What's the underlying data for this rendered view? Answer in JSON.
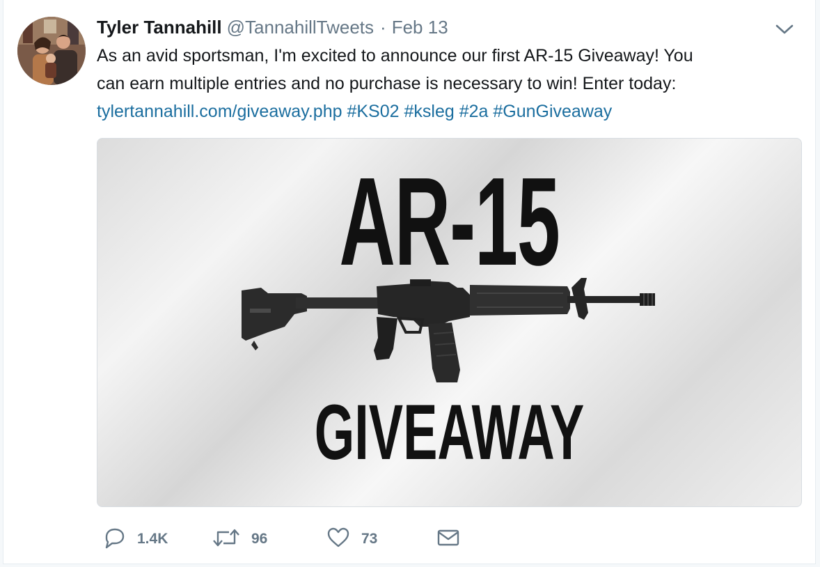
{
  "user": {
    "name": "Tyler Tannahill",
    "handle": "@TannahillTweets",
    "separator": "·",
    "timestamp": "Feb 13"
  },
  "tweet": {
    "line1": "As an avid sportsman, I'm excited to announce our first AR-15 Giveaway! You",
    "line2": "can earn multiple entries and no purchase is necessary to win! Enter today:",
    "link": "tylertannahill.com/giveaway.php",
    "hashtags": [
      "#KS02",
      "#ksleg",
      "#2a",
      "#GunGiveaway"
    ]
  },
  "media": {
    "title": "AR-15",
    "subtitle": "GIVEAWAY"
  },
  "actions": {
    "reply_icon": "reply-icon",
    "reply_count": "1.4K",
    "retweet_icon": "retweet-icon",
    "retweet_count": "96",
    "like_icon": "heart-icon",
    "like_count": "73",
    "dm_icon": "envelope-icon"
  },
  "colors": {
    "link": "#1b6e9f",
    "secondary_text": "#657786",
    "text": "#14171a"
  }
}
